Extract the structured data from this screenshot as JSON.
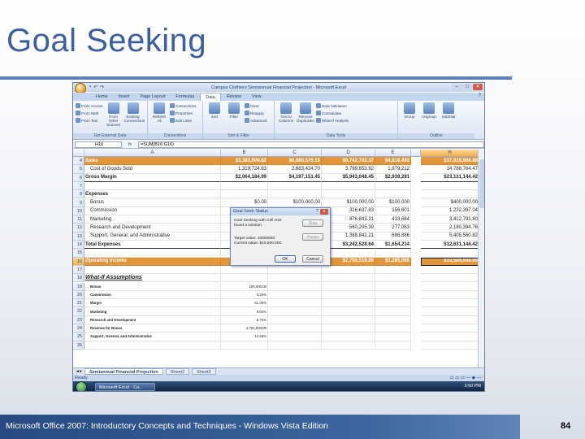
{
  "slide": {
    "title": "Goal Seeking",
    "footer": "Microsoft Office 2007: Introductory Concepts and Techniques - Windows Vista Edition",
    "page_number": "84"
  },
  "excel": {
    "window_title": "Campus Clothiers Semiannual Financial Projection - Microsoft Excel",
    "tabs": [
      "Home",
      "Insert",
      "Page Layout",
      "Formulas",
      "Data",
      "Review",
      "View"
    ],
    "active_tab": "Data",
    "ribbon_groups": [
      {
        "name": "Get External Data",
        "items": [
          "From Access",
          "From Web",
          "From Text",
          "From Other Sources",
          "Existing Connections"
        ]
      },
      {
        "name": "Connections",
        "items": [
          "Refresh All",
          "Connections",
          "Properties",
          "Edit Links"
        ]
      },
      {
        "name": "Sort & Filter",
        "items": [
          "Sort",
          "Filter",
          "Clear",
          "Reapply",
          "Advanced"
        ]
      },
      {
        "name": "Data Tools",
        "items": [
          "Text to Columns",
          "Remove Duplicates",
          "Data Validation",
          "Consolidate",
          "What-If Analysis"
        ]
      },
      {
        "name": "Outline",
        "items": [
          "Group",
          "Ungroup",
          "Subtotal"
        ]
      }
    ],
    "name_box": "H16",
    "formula": "=SUM(B16:G16)",
    "columns": [
      "A",
      "B",
      "C",
      "D",
      "E",
      "H"
    ],
    "rows": [
      {
        "n": "4",
        "a": "Sales",
        "b": "$3,383,909.82",
        "c": "$6,880,576.15",
        "d": "$9,742,702.37",
        "e": "$4,818,493",
        "h": "$37,919,908.89",
        "style": "hl"
      },
      {
        "n": "5",
        "a": "Cost of Goods Sold",
        "b": "1,319,724.83",
        "c": "2,683,424.70",
        "d": "3,799,653.92",
        "e": "1,879,212",
        "h": "14,788,764.47",
        "style": "ind"
      },
      {
        "n": "6",
        "a": "Gross Margin",
        "b": "$2,064,184.99",
        "c": "$4,197,151.45",
        "d": "$5,943,048.45",
        "e": "$2,939,281",
        "h": "$23,131,144.42",
        "style": "total"
      },
      {
        "n": "7",
        "a": "",
        "b": "",
        "c": "",
        "d": "",
        "e": "",
        "h": "",
        "style": ""
      },
      {
        "n": "8",
        "a": "Expenses",
        "b": "",
        "c": "",
        "d": "",
        "e": "",
        "h": "",
        "style": "bold"
      },
      {
        "n": "9",
        "a": "Bonus",
        "b": "$0.00",
        "c": "$100,000.00",
        "d": "$100,000.00",
        "e": "$100,000",
        "h": "$400,000.00",
        "style": "ind"
      },
      {
        "n": "10",
        "a": "Commission",
        "b": "",
        "c": "",
        "d": "316,637.83",
        "e": "156,601",
        "h": "1,232,397.04",
        "style": "ind"
      },
      {
        "n": "11",
        "a": "Marketing",
        "b": "",
        "c": "",
        "d": "876,843.21",
        "e": "433,664",
        "h": "3,412,791.80",
        "style": "ind"
      },
      {
        "n": "12",
        "a": "Research and Development",
        "b": "",
        "c": "",
        "d": "560,205.39",
        "e": "277,063",
        "h": "2,180,394.76",
        "style": "ind"
      },
      {
        "n": "13",
        "a": "Support, General, and Administrative",
        "b": "",
        "c": "",
        "d": "1,388,842.21",
        "e": "686,886",
        "h": "5,405,560.82",
        "style": "ind"
      },
      {
        "n": "14",
        "a": "Total Expenses",
        "b": "$1",
        "c": "",
        "d": "$3,242,528.64",
        "e": "$1,654,214",
        "h": "$12,631,144.42",
        "style": "total"
      },
      {
        "n": "15",
        "a": "",
        "b": "",
        "c": "",
        "d": "",
        "e": "",
        "h": "",
        "style": ""
      },
      {
        "n": "16",
        "a": "Operating Income",
        "b": "$972,697.93",
        "c": "$1,977,807.50",
        "d": "$2,700,519.80",
        "e": "$1,285,066",
        "h": "$10,500,000.00",
        "style": "hl"
      },
      {
        "n": "17",
        "a": "",
        "b": "",
        "c": "",
        "d": "",
        "e": "",
        "h": "",
        "style": ""
      },
      {
        "n": "18",
        "a": "What-If Assumptions",
        "b": "",
        "c": "",
        "d": "",
        "e": "",
        "h": "",
        "style": "whatif"
      },
      {
        "n": "19",
        "a": "Bonus",
        "b": "100,000.00",
        "c": "",
        "d": "",
        "e": "",
        "h": "",
        "style": "sm"
      },
      {
        "n": "20",
        "a": "Commission",
        "b": "3.25%",
        "c": "",
        "d": "",
        "e": "",
        "h": "",
        "style": "sm"
      },
      {
        "n": "21",
        "a": "Margin",
        "b": "61.00%",
        "c": "",
        "d": "",
        "e": "",
        "h": "",
        "style": "sm"
      },
      {
        "n": "22",
        "a": "Marketing",
        "b": "9.00%",
        "c": "",
        "d": "",
        "e": "",
        "h": "",
        "style": "sm"
      },
      {
        "n": "23",
        "a": "Research and Development",
        "b": "5.75%",
        "c": "",
        "d": "",
        "e": "",
        "h": "",
        "style": "sm"
      },
      {
        "n": "24",
        "a": "Revenue for Bonus",
        "b": "4,750,000.00",
        "c": "",
        "d": "",
        "e": "",
        "h": "",
        "style": "sm"
      },
      {
        "n": "25",
        "a": "Support, General, and Administrative",
        "b": "14.26%",
        "c": "",
        "d": "",
        "e": "",
        "h": "",
        "style": "sm"
      },
      {
        "n": "26",
        "a": "",
        "b": "",
        "c": "",
        "d": "",
        "e": "",
        "h": "",
        "style": ""
      }
    ],
    "sheet_tabs": [
      "Semiannual Financial Projection",
      "Sheet2",
      "Sheet3"
    ],
    "status": "Ready",
    "taskbar_app": "Microsoft Excel - Ca...",
    "clock": "3:50 PM",
    "dialog": {
      "title": "Goal Seek Status",
      "question": "?",
      "close": "x",
      "message": "Goal Seeking with Cell H16 found a solution.",
      "target_value": "Target value:   10500000",
      "current_value": "Current value:   $10,500,000.",
      "step": "Step",
      "pause": "Pause",
      "ok": "OK",
      "cancel": "Cancel"
    }
  }
}
